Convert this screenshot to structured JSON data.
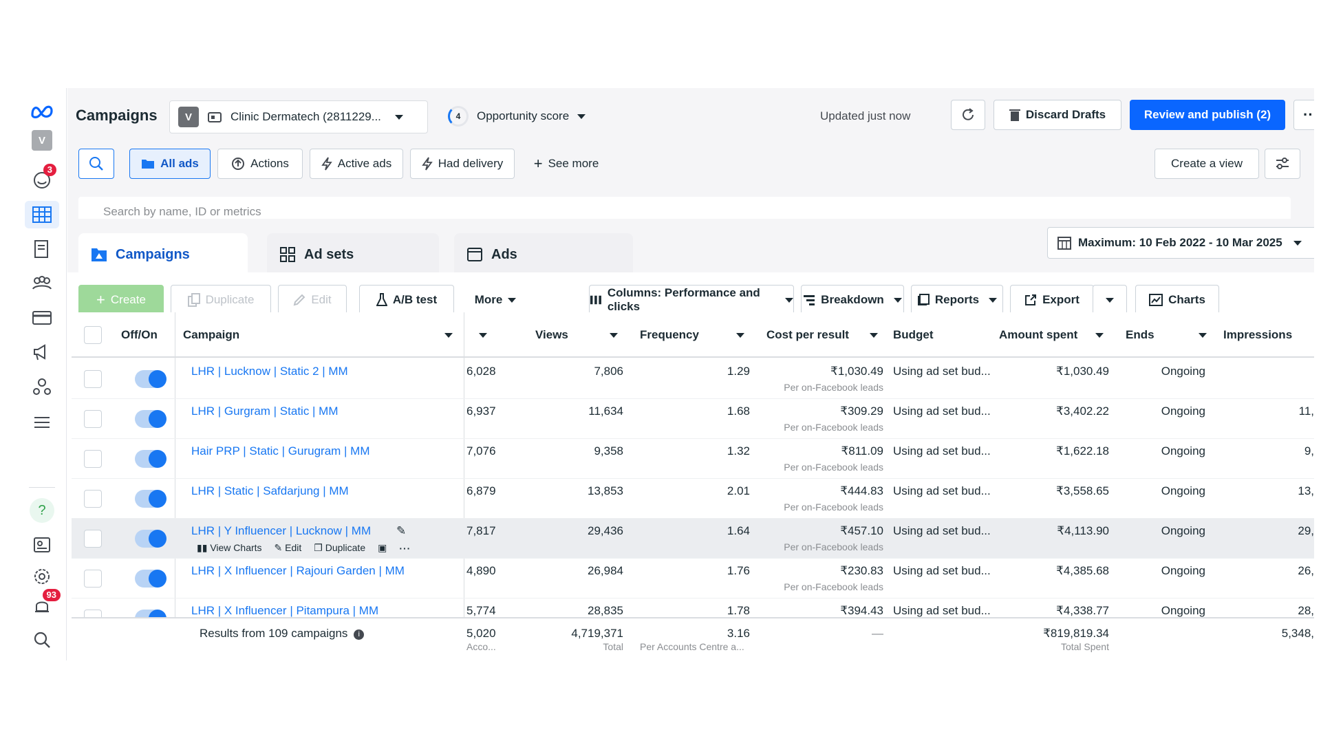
{
  "header": {
    "title": "Campaigns",
    "account_initial": "V",
    "account_name": "Clinic Dermatech (2811229...",
    "opportunity_count": "4",
    "opportunity_label": "Opportunity score",
    "updated": "Updated just now",
    "discard": "Discard Drafts",
    "publish": "Review and publish (2)"
  },
  "rail": {
    "avatar_initial": "V",
    "notifications_badge": "3",
    "alerts_badge": "93"
  },
  "filters": {
    "all_ads": "All ads",
    "actions": "Actions",
    "active_ads": "Active ads",
    "had_delivery": "Had delivery",
    "see_more": "See more",
    "create_view": "Create a view",
    "search_placeholder": "Search by name, ID or metrics"
  },
  "tabs": {
    "campaigns": "Campaigns",
    "adsets": "Ad sets",
    "ads": "Ads",
    "date_range": "Maximum: 10 Feb 2022 - 10 Mar 2025"
  },
  "toolbar": {
    "create": "Create",
    "duplicate": "Duplicate",
    "edit": "Edit",
    "ab_test": "A/B test",
    "more": "More",
    "columns": "Columns: Performance and clicks",
    "breakdown": "Breakdown",
    "reports": "Reports",
    "export": "Export",
    "charts": "Charts"
  },
  "columns": {
    "offon": "Off/On",
    "campaign": "Campaign",
    "views": "Views",
    "frequency": "Frequency",
    "cost": "Cost per result",
    "budget": "Budget",
    "amount": "Amount spent",
    "ends": "Ends",
    "impressions": "Impressions"
  },
  "rows": [
    {
      "name": "LHR | Lucknow | Static 2 | MM",
      "reach": "6,028",
      "views": "7,806",
      "frequency": "1.29",
      "cost": "₹1,030.49",
      "cost_sub": "Per on-Facebook leads",
      "budget": "Using ad set bud...",
      "amount": "₹1,030.49",
      "ends": "Ongoing",
      "impressions": ""
    },
    {
      "name": "LHR | Gurgram | Static | MM",
      "reach": "6,937",
      "views": "11,634",
      "frequency": "1.68",
      "cost": "₹309.29",
      "cost_sub": "Per on-Facebook leads",
      "budget": "Using ad set bud...",
      "amount": "₹3,402.22",
      "ends": "Ongoing",
      "impressions": "11,"
    },
    {
      "name": "Hair PRP | Static | Gurugram | MM",
      "reach": "7,076",
      "views": "9,358",
      "frequency": "1.32",
      "cost": "₹811.09",
      "cost_sub": "Per on-Facebook leads",
      "budget": "Using ad set bud...",
      "amount": "₹1,622.18",
      "ends": "Ongoing",
      "impressions": "9,"
    },
    {
      "name": "LHR | Static | Safdarjung | MM",
      "reach": "6,879",
      "views": "13,853",
      "frequency": "2.01",
      "cost": "₹444.83",
      "cost_sub": "Per on-Facebook leads",
      "budget": "Using ad set bud...",
      "amount": "₹3,558.65",
      "ends": "Ongoing",
      "impressions": "13,"
    },
    {
      "name": "LHR | Y Influencer | Lucknow | MM",
      "reach": "7,817",
      "views": "29,436",
      "frequency": "1.64",
      "cost": "₹457.10",
      "cost_sub": "Per on-Facebook leads",
      "budget": "Using ad set bud...",
      "amount": "₹4,113.90",
      "ends": "Ongoing",
      "impressions": "29,"
    },
    {
      "name": "LHR | X Influencer | Rajouri Garden | MM",
      "reach": "4,890",
      "views": "26,984",
      "frequency": "1.76",
      "cost": "₹230.83",
      "cost_sub": "Per on-Facebook leads",
      "budget": "Using ad set bud...",
      "amount": "₹4,385.68",
      "ends": "Ongoing",
      "impressions": "26,"
    },
    {
      "name": "LHR | X Influencer | Pitampura | MM",
      "reach": "5,774",
      "views": "28,835",
      "frequency": "1.78",
      "cost": "₹394.43",
      "cost_sub": "",
      "budget": "Using ad set bud...",
      "amount": "₹4,338.77",
      "ends": "Ongoing",
      "impressions": "28,"
    }
  ],
  "row_actions": {
    "view_charts": "View Charts",
    "edit": "Edit",
    "duplicate": "Duplicate"
  },
  "footer": {
    "results": "Results from 109 campaigns",
    "reach": "5,020",
    "reach_sub": "Acco...",
    "views": "4,719,371",
    "views_sub": "Total",
    "frequency": "3.16",
    "frequency_sub": "Per Accounts Centre a...",
    "cost": "—",
    "amount": "₹819,819.34",
    "amount_sub": "Total Spent",
    "impressions": "5,348,"
  }
}
